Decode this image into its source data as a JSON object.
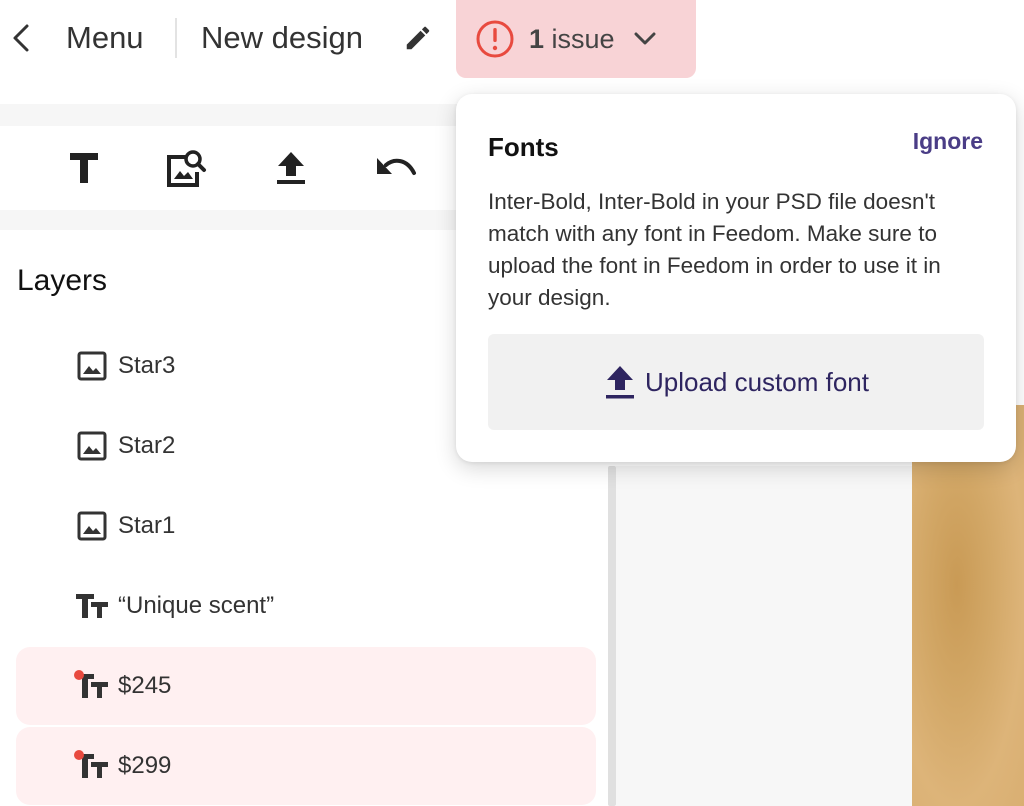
{
  "header": {
    "menu_label": "Menu",
    "design_title": "New design",
    "issue_count": "1",
    "issue_word": "issue"
  },
  "toolbar": {
    "tools": [
      "text-tool",
      "image-search-tool",
      "upload-tool",
      "undo-tool"
    ]
  },
  "layers": {
    "title": "Layers",
    "items": [
      {
        "label": "Star3",
        "type": "image",
        "error": false
      },
      {
        "label": "Star2",
        "type": "image",
        "error": false
      },
      {
        "label": "Star1",
        "type": "image",
        "error": false
      },
      {
        "label": "“Unique scent”",
        "type": "text",
        "error": false
      },
      {
        "label": "$245",
        "type": "text",
        "error": true
      },
      {
        "label": "$299",
        "type": "text",
        "error": true
      }
    ]
  },
  "popover": {
    "title": "Fonts",
    "ignore_label": "Ignore",
    "message": "Inter-Bold, Inter-Bold in your PSD file doesn't match with any font in Feedom. Make sure to upload the font in Feedom in order to use it in your design.",
    "upload_label": "Upload custom font"
  },
  "colors": {
    "issue_bg": "#f8d3d6",
    "alert_red": "#e84a3f",
    "error_row_bg": "#fff0f1",
    "accent": "#4a3d86",
    "artwork": "#d2a766"
  }
}
